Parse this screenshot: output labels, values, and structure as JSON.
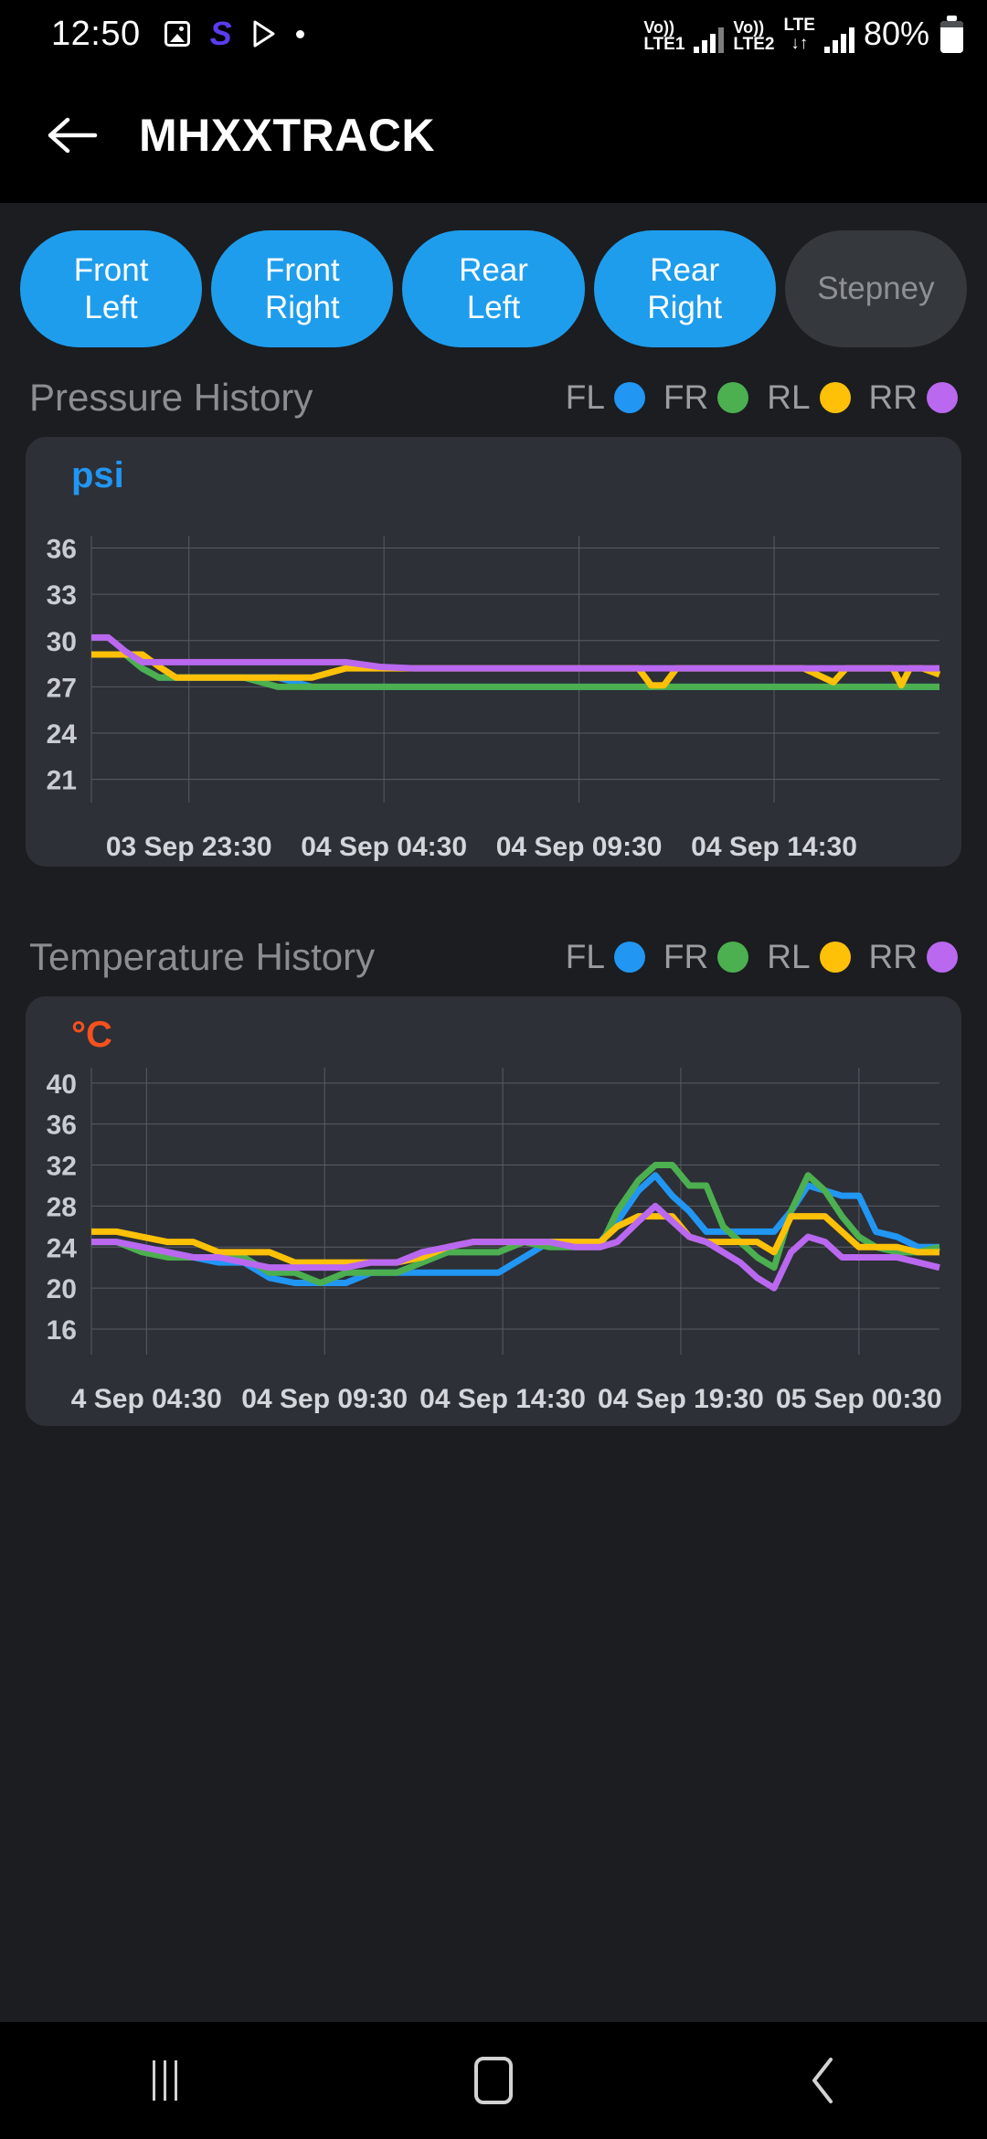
{
  "statusbar": {
    "clock": "12:50",
    "icons": [
      "photo-icon",
      "samsung-s-icon",
      "play-store-icon",
      "dot-icon"
    ],
    "network1": {
      "volte": "Vo))",
      "lte": "LTE1"
    },
    "network2": {
      "volte": "Vo))",
      "lte": "LTE2",
      "data": "LTE",
      "arrows": "↓↑"
    },
    "battery_text": "80%"
  },
  "appbar": {
    "back_icon": "back-arrow-icon",
    "title": "MHXXTRACK"
  },
  "tires": [
    {
      "id": "front-left",
      "line1": "Front",
      "line2": "Left",
      "active": true
    },
    {
      "id": "front-right",
      "line1": "Front",
      "line2": "Right",
      "active": true
    },
    {
      "id": "rear-left",
      "line1": "Rear",
      "line2": "Left",
      "active": true
    },
    {
      "id": "rear-right",
      "line1": "Rear",
      "line2": "Right",
      "active": true
    },
    {
      "id": "stepney",
      "line1": "Stepney",
      "line2": "",
      "active": false
    }
  ],
  "colors": {
    "fl": "#2196f3",
    "fr": "#4caf50",
    "rl": "#ffc107",
    "rr": "#ba68f0",
    "chip_active": "#1f9ded",
    "chip_inactive": "#35383c",
    "card_bg": "#2d3036",
    "psi_label": "#2196f3",
    "celsius_label": "#f4511e"
  },
  "legend": [
    {
      "label": "FL",
      "color": "#2196f3"
    },
    {
      "label": "FR",
      "color": "#4caf50"
    },
    {
      "label": "RL",
      "color": "#ffc107"
    },
    {
      "label": "RR",
      "color": "#ba68f0"
    }
  ],
  "pressure_section": {
    "title": "Pressure History",
    "unit": "psi"
  },
  "temperature_section": {
    "title": "Temperature History",
    "unit": "°C"
  },
  "navbar": {
    "recent_label": "recent-apps-icon",
    "home_label": "home-icon",
    "back_label": "back-icon"
  },
  "chart_data": [
    {
      "id": "pressure-history",
      "type": "line",
      "title": "Pressure History",
      "ylabel": "psi",
      "xlabel": "",
      "ylim": [
        19.5,
        36.8
      ],
      "yticks": [
        36,
        33,
        30,
        27,
        24,
        21
      ],
      "grid": true,
      "legend_position": "top-right",
      "xtick_labels": [
        "03 Sep 23:30",
        "04 Sep 04:30",
        "04 Sep 09:30",
        "04 Sep 14:30"
      ],
      "xtick_positions": [
        0.115,
        0.345,
        0.575,
        0.805
      ],
      "x": [
        0.0,
        0.02,
        0.04,
        0.06,
        0.08,
        0.1,
        0.12,
        0.14,
        0.18,
        0.22,
        0.26,
        0.3,
        0.34,
        0.38,
        0.42,
        0.46,
        0.5,
        0.54,
        0.58,
        0.62,
        0.645,
        0.66,
        0.675,
        0.69,
        0.72,
        0.76,
        0.8,
        0.84,
        0.875,
        0.89,
        0.92,
        0.945,
        0.955,
        0.965,
        0.98,
        1.0
      ],
      "series": [
        {
          "name": "FL",
          "color": "#2196f3",
          "values": [
            29.1,
            29.1,
            29.1,
            28.2,
            27.6,
            27.6,
            27.6,
            27.6,
            27.6,
            27.6,
            27.0,
            27.0,
            27.0,
            27.0,
            27.0,
            27.0,
            27.0,
            27.0,
            27.0,
            27.0,
            27.0,
            27.0,
            27.0,
            27.0,
            27.0,
            27.0,
            27.0,
            27.0,
            27.0,
            27.0,
            27.0,
            27.0,
            27.0,
            27.0,
            27.0,
            27.0
          ]
        },
        {
          "name": "FR",
          "color": "#4caf50",
          "values": [
            29.1,
            29.1,
            29.1,
            28.2,
            27.6,
            27.6,
            27.6,
            27.6,
            27.6,
            27.0,
            27.0,
            27.0,
            27.0,
            27.0,
            27.0,
            27.0,
            27.0,
            27.0,
            27.0,
            27.0,
            27.0,
            27.0,
            27.0,
            27.0,
            27.0,
            27.0,
            27.0,
            27.0,
            27.0,
            27.0,
            27.0,
            27.0,
            27.0,
            27.0,
            27.0,
            27.0
          ]
        },
        {
          "name": "RL",
          "color": "#ffc107",
          "values": [
            29.1,
            29.1,
            29.1,
            29.1,
            28.3,
            27.6,
            27.6,
            27.6,
            27.6,
            27.6,
            27.6,
            28.2,
            28.2,
            28.2,
            28.2,
            28.2,
            28.2,
            28.2,
            28.2,
            28.2,
            28.2,
            27.1,
            27.1,
            28.2,
            28.2,
            28.2,
            28.2,
            28.2,
            27.3,
            28.2,
            28.2,
            28.2,
            27.1,
            28.2,
            28.2,
            27.8
          ]
        },
        {
          "name": "RR",
          "color": "#ba68f0",
          "values": [
            30.2,
            30.2,
            29.3,
            28.6,
            28.6,
            28.6,
            28.6,
            28.6,
            28.6,
            28.6,
            28.6,
            28.6,
            28.3,
            28.2,
            28.2,
            28.2,
            28.2,
            28.2,
            28.2,
            28.2,
            28.2,
            28.2,
            28.2,
            28.2,
            28.2,
            28.2,
            28.2,
            28.2,
            28.2,
            28.2,
            28.2,
            28.2,
            28.2,
            28.2,
            28.2,
            28.2
          ]
        }
      ]
    },
    {
      "id": "temperature-history",
      "type": "line",
      "title": "Temperature History",
      "ylabel": "°C",
      "xlabel": "",
      "ylim": [
        13.5,
        41.5
      ],
      "yticks": [
        40,
        36,
        32,
        28,
        24,
        20,
        16
      ],
      "grid": true,
      "legend_position": "top-right",
      "xtick_labels": [
        "4 Sep 04:30",
        "04 Sep 09:30",
        "04 Sep 14:30",
        "04 Sep 19:30",
        "05 Sep 00:30"
      ],
      "xtick_positions": [
        0.065,
        0.275,
        0.485,
        0.695,
        0.905
      ],
      "x": [
        0.0,
        0.03,
        0.06,
        0.09,
        0.12,
        0.15,
        0.18,
        0.21,
        0.24,
        0.27,
        0.3,
        0.33,
        0.36,
        0.39,
        0.42,
        0.45,
        0.48,
        0.51,
        0.54,
        0.57,
        0.6,
        0.62,
        0.645,
        0.665,
        0.685,
        0.705,
        0.725,
        0.745,
        0.765,
        0.785,
        0.805,
        0.825,
        0.845,
        0.865,
        0.885,
        0.905,
        0.925,
        0.95,
        0.975,
        1.0
      ],
      "series": [
        {
          "name": "FL",
          "color": "#2196f3",
          "values": [
            24.5,
            24.5,
            24.0,
            23.5,
            23.0,
            22.5,
            22.5,
            21.0,
            20.5,
            20.5,
            20.5,
            21.5,
            21.5,
            21.5,
            21.5,
            21.5,
            21.5,
            23.0,
            24.5,
            24.5,
            24.5,
            26.5,
            29.5,
            31.0,
            29.0,
            27.5,
            25.5,
            25.5,
            25.5,
            25.5,
            25.5,
            27.5,
            30.0,
            29.5,
            29.0,
            29.0,
            25.5,
            25.0,
            24.0,
            24.0
          ]
        },
        {
          "name": "FR",
          "color": "#4caf50",
          "values": [
            24.5,
            24.5,
            23.5,
            23.0,
            23.0,
            23.0,
            23.0,
            21.5,
            21.5,
            20.5,
            21.5,
            21.5,
            21.5,
            22.5,
            23.5,
            23.5,
            23.5,
            24.5,
            24.0,
            24.0,
            24.0,
            27.5,
            30.5,
            32.0,
            32.0,
            30.0,
            30.0,
            26.0,
            24.5,
            23.0,
            22.0,
            27.5,
            31.0,
            29.5,
            27.0,
            25.0,
            24.0,
            23.5,
            23.5,
            24.0
          ]
        },
        {
          "name": "RL",
          "color": "#ffc107",
          "values": [
            25.5,
            25.5,
            25.0,
            24.5,
            24.5,
            23.5,
            23.5,
            23.5,
            22.5,
            22.5,
            22.5,
            22.5,
            22.5,
            23.0,
            24.0,
            24.5,
            24.5,
            24.5,
            24.5,
            24.5,
            24.5,
            26.0,
            27.0,
            27.0,
            27.0,
            25.0,
            24.5,
            24.5,
            24.5,
            24.5,
            23.5,
            27.0,
            27.0,
            27.0,
            25.5,
            24.0,
            24.0,
            24.0,
            23.5,
            23.5
          ]
        },
        {
          "name": "RR",
          "color": "#ba68f0",
          "values": [
            24.5,
            24.5,
            24.0,
            23.5,
            23.0,
            23.0,
            22.5,
            22.0,
            22.0,
            22.0,
            22.0,
            22.5,
            22.5,
            23.5,
            24.0,
            24.5,
            24.5,
            24.5,
            24.5,
            24.0,
            24.0,
            24.5,
            26.5,
            28.0,
            26.5,
            25.0,
            24.5,
            23.5,
            22.5,
            21.0,
            20.0,
            23.5,
            25.0,
            24.5,
            23.0,
            23.0,
            23.0,
            23.0,
            22.5,
            22.0
          ]
        }
      ]
    }
  ]
}
